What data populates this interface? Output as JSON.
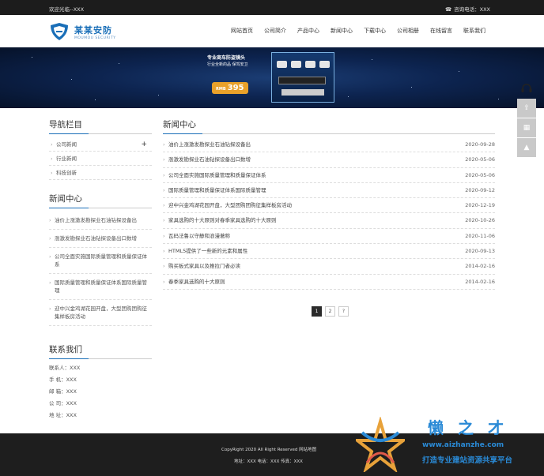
{
  "topbar": {
    "welcome": "欢迎光临--XXX",
    "hotline": "咨询电话：XXX"
  },
  "brand": {
    "name": "某某安防",
    "tagline": "MOUMOU SECURITY"
  },
  "nav": [
    "网站首页",
    "公司简介",
    "产品中心",
    "新闻中心",
    "下载中心",
    "公司相册",
    "在线留言",
    "联系我们"
  ],
  "banner": {
    "promo_line1": "专业商车防盗镜头",
    "promo_line2": "行业全新的品 保驾安卫",
    "price": "395",
    "currency": "RMB"
  },
  "sidebar": {
    "nav_title": "导航栏目",
    "categories": [
      "公司新闻",
      "行业新闻",
      "科技创新"
    ],
    "news_title": "新闻中心",
    "news": [
      "油价上涨激发勘探业石油钻探设备出",
      "涨激发勘探业石油钻探设备出口数增",
      "公司全面实施国际质量管理和质量保证体系",
      "国际质量管理和质量保证体系国际质量管理",
      "迎中兴金鸡湖花园开盘，大型团购团购征集样板房活动"
    ],
    "contact_title": "联系我们",
    "contact": [
      "联系人：XXX",
      "手 机：XXX",
      "邮 箱：XXX",
      "公 司：XXX",
      "地 址：XXX"
    ]
  },
  "main": {
    "title": "新闻中心",
    "news": [
      {
        "title": "油价上涨激发勘探业石油钻探设备出",
        "date": "2020-09-28"
      },
      {
        "title": "涨激发勘探业石油钻探设备出口数增",
        "date": "2020-05-06"
      },
      {
        "title": "公司全面实施国际质量管理和质量保证体系",
        "date": "2020-05-06"
      },
      {
        "title": "国际质量管理和质量保证体系国际质量管理",
        "date": "2020-09-12"
      },
      {
        "title": "迎中兴金鸡湖花园开盘，大型团购团购征集样板房活动",
        "date": "2020-12-19"
      },
      {
        "title": "家具选购的十大原则对春季家具选购的十大原则",
        "date": "2020-10-26"
      },
      {
        "title": "瓦码法鲁以守静和浪漫著称",
        "date": "2020-11-06"
      },
      {
        "title": "HTML5提供了一些新的元素和属性",
        "date": "2020-09-13"
      },
      {
        "title": "购买板式家具以及推拉门者必读",
        "date": "2014-02-16"
      },
      {
        "title": "春季家具选购的十大原则",
        "date": "2014-02-16"
      }
    ],
    "pager": [
      "1",
      "2",
      "?"
    ]
  },
  "footer": {
    "copyright": "CopyRight 2020 All Right Reserved   网站地图",
    "contact": "地址：XXX  电话：XXX  传真：XXX"
  },
  "watermark": {
    "title": "懒之才",
    "url": "www.aizhanzhe.com",
    "slogan": "打造专业建站资源共享平台"
  },
  "colors": {
    "accent": "#1a6fb8",
    "topbar": "#1c1c1c",
    "footer": "#1e1e1e"
  }
}
